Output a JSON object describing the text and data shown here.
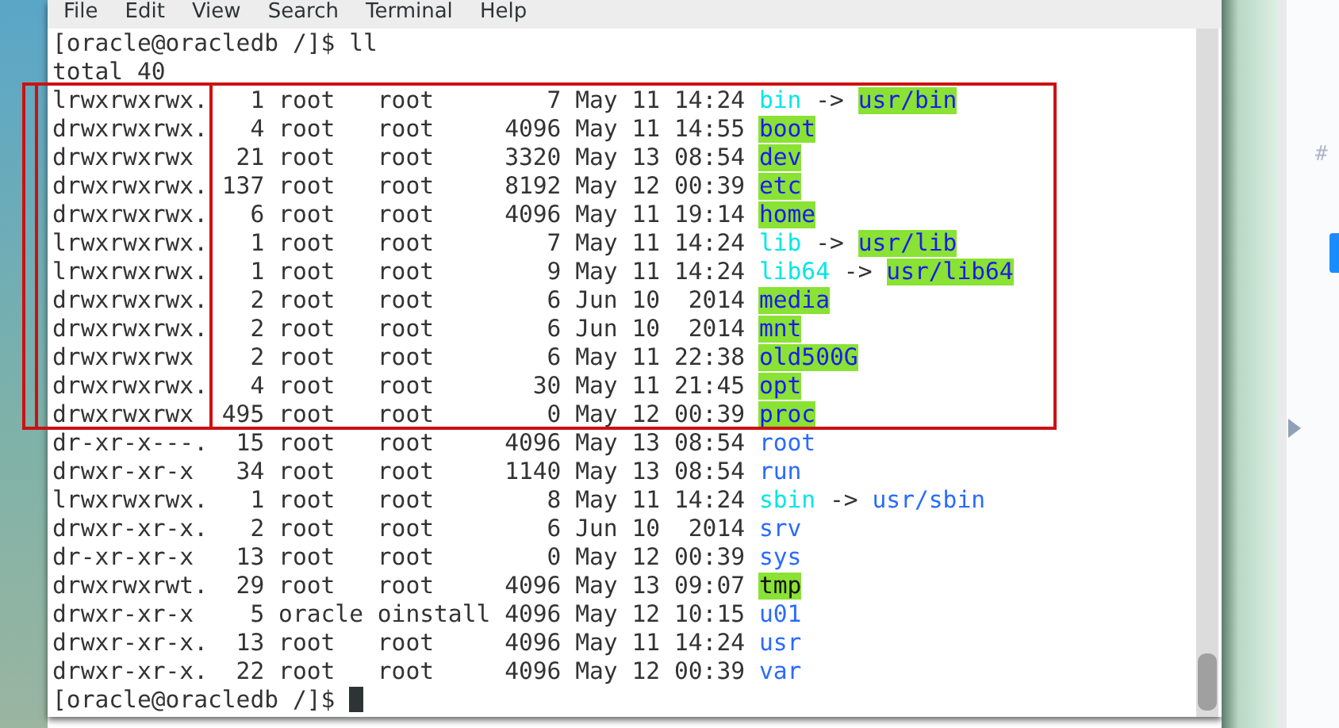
{
  "menu": [
    "File",
    "Edit",
    "View",
    "Search",
    "Terminal",
    "Help"
  ],
  "terminal": {
    "prompt": "[oracle@oracledb /]$",
    "command": "ll",
    "total": "total 40",
    "rows": [
      {
        "info": "lrwxrwxrwx.   1 root   root        7 May 11 14:24",
        "name": "bin",
        "kind": "link",
        "arrow": "->",
        "target": {
          "name": "usr/bin",
          "kind": "open_dir"
        }
      },
      {
        "info": "drwxrwxrwx.   4 root   root     4096 May 11 14:55",
        "name": "boot",
        "kind": "open_dir"
      },
      {
        "info": "drwxrwxrwx   21 root   root     3320 May 13 08:54",
        "name": "dev",
        "kind": "open_dir"
      },
      {
        "info": "drwxrwxrwx. 137 root   root     8192 May 12 00:39",
        "name": "etc",
        "kind": "open_dir"
      },
      {
        "info": "drwxrwxrwx.   6 root   root     4096 May 11 19:14",
        "name": "home",
        "kind": "open_dir"
      },
      {
        "info": "lrwxrwxrwx.   1 root   root        7 May 11 14:24",
        "name": "lib",
        "kind": "link",
        "arrow": "->",
        "target": {
          "name": "usr/lib",
          "kind": "open_dir"
        }
      },
      {
        "info": "lrwxrwxrwx.   1 root   root        9 May 11 14:24",
        "name": "lib64",
        "kind": "link",
        "arrow": "->",
        "target": {
          "name": "usr/lib64",
          "kind": "open_dir"
        }
      },
      {
        "info": "drwxrwxrwx.   2 root   root        6 Jun 10  2014",
        "name": "media",
        "kind": "open_dir"
      },
      {
        "info": "drwxrwxrwx.   2 root   root        6 Jun 10  2014",
        "name": "mnt",
        "kind": "open_dir"
      },
      {
        "info": "drwxrwxrwx    2 root   root        6 May 11 22:38",
        "name": "old500G",
        "kind": "open_dir"
      },
      {
        "info": "drwxrwxrwx.   4 root   root       30 May 11 21:45",
        "name": "opt",
        "kind": "open_dir"
      },
      {
        "info": "drwxrwxrwx  495 root   root        0 May 12 00:39",
        "name": "proc",
        "kind": "open_dir"
      },
      {
        "info": "dr-xr-x---.  15 root   root     4096 May 13 08:54",
        "name": "root",
        "kind": "dir"
      },
      {
        "info": "drwxr-xr-x   34 root   root     1140 May 13 08:54",
        "name": "run",
        "kind": "dir"
      },
      {
        "info": "lrwxrwxrwx.   1 root   root        8 May 11 14:24",
        "name": "sbin",
        "kind": "link",
        "arrow": "->",
        "target": {
          "name": "usr/sbin",
          "kind": "dir"
        }
      },
      {
        "info": "drwxr-xr-x.   2 root   root        6 Jun 10  2014",
        "name": "srv",
        "kind": "dir"
      },
      {
        "info": "dr-xr-xr-x   13 root   root        0 May 12 00:39",
        "name": "sys",
        "kind": "dir"
      },
      {
        "info": "drwxrwxrwt.  29 root   root     4096 May 13 09:07",
        "name": "tmp",
        "kind": "sticky_dir"
      },
      {
        "info": "drwxr-xr-x    5 oracle oinstall 4096 May 12 10:15",
        "name": "u01",
        "kind": "dir"
      },
      {
        "info": "drwxr-xr-x.  13 root   root     4096 May 11 14:24",
        "name": "usr",
        "kind": "dir"
      },
      {
        "info": "drwxr-xr-x.  22 root   root     4096 May 12 00:39",
        "name": "var",
        "kind": "dir"
      }
    ],
    "final_prompt": "[oracle@oracledb /]$"
  },
  "highlights": {
    "permissions_column": true,
    "upper_rows": true
  },
  "side_panel": {
    "text": "#"
  }
}
